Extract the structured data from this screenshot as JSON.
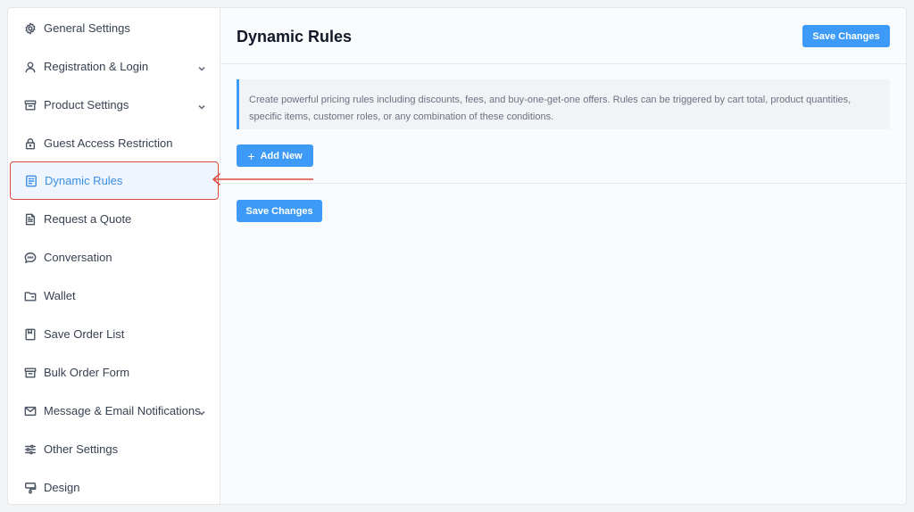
{
  "sidebar": {
    "items": [
      {
        "label": "General Settings",
        "icon": "gear-icon",
        "chevron": false
      },
      {
        "label": "Registration & Login",
        "icon": "user-icon",
        "chevron": true
      },
      {
        "label": "Product Settings",
        "icon": "archive-box-icon",
        "chevron": true
      },
      {
        "label": "Guest Access Restriction",
        "icon": "lock-icon",
        "chevron": false
      },
      {
        "label": "Dynamic Rules",
        "icon": "rules-card-icon",
        "chevron": false,
        "active": true
      },
      {
        "label": "Request a Quote",
        "icon": "document-icon",
        "chevron": false
      },
      {
        "label": "Conversation",
        "icon": "chat-bubble-icon",
        "chevron": false
      },
      {
        "label": "Wallet",
        "icon": "wallet-icon",
        "chevron": false
      },
      {
        "label": "Save Order List",
        "icon": "bookmark-icon",
        "chevron": false
      },
      {
        "label": "Bulk Order Form",
        "icon": "box-icon",
        "chevron": false
      },
      {
        "label": "Message & Email Notifications",
        "icon": "mail-icon",
        "chevron": true
      },
      {
        "label": "Other Settings",
        "icon": "sliders-icon",
        "chevron": false
      },
      {
        "label": "Design",
        "icon": "paint-icon",
        "chevron": false
      }
    ]
  },
  "header": {
    "title": "Dynamic Rules",
    "save_label": "Save Changes"
  },
  "main": {
    "info_text": "Create powerful pricing rules including discounts, fees, and buy-one-get-one offers. Rules can be triggered by cart total, product quantities, specific items, customer roles, or any combination of these conditions.",
    "add_label": "Add New",
    "save_label": "Save Changes"
  },
  "colors": {
    "accent": "#3d9bf7",
    "highlight_border": "#dc4a3d",
    "active_text": "#3b8fe6"
  }
}
